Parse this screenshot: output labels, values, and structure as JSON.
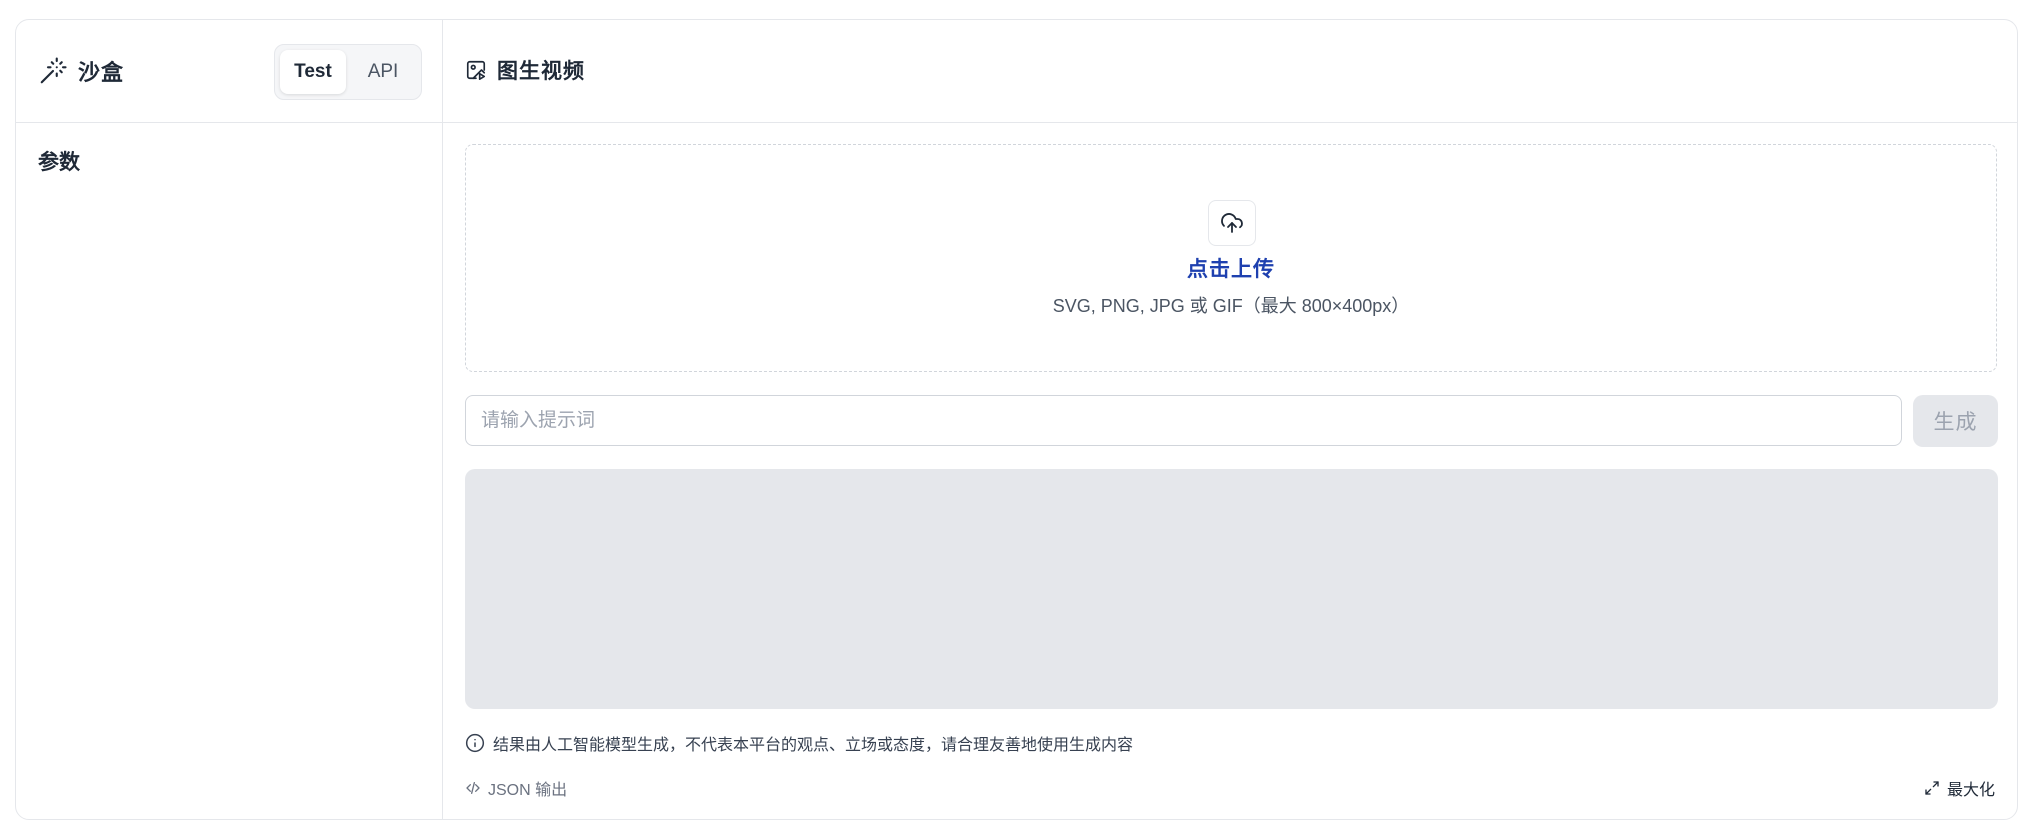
{
  "sidebar": {
    "title": "沙盒",
    "tabs": [
      {
        "label": "Test",
        "active": true
      },
      {
        "label": "API",
        "active": false
      }
    ],
    "params_title": "参数"
  },
  "main": {
    "title": "图生视频",
    "upload": {
      "link_text": "点击上传",
      "hint": "SVG, PNG, JPG 或 GIF（最大 800×400px）"
    },
    "prompt": {
      "placeholder": "请输入提示词",
      "value": ""
    },
    "generate_label": "生成",
    "disclaimer": "结果由人工智能模型生成，不代表本平台的观点、立场或态度，请合理友善地使用生成内容",
    "json_output_label": "JSON 输出",
    "maximize_label": "最大化"
  },
  "icons": {
    "brand": "magic-wand-icon",
    "title": "image-to-video-icon",
    "upload": "cloud-upload-icon",
    "info": "info-circle-icon",
    "code": "code-icon",
    "maximize": "expand-icon"
  },
  "colors": {
    "accent_link": "#1e40af",
    "border": "#e5e7eb",
    "result_bg": "#e5e7eb"
  }
}
